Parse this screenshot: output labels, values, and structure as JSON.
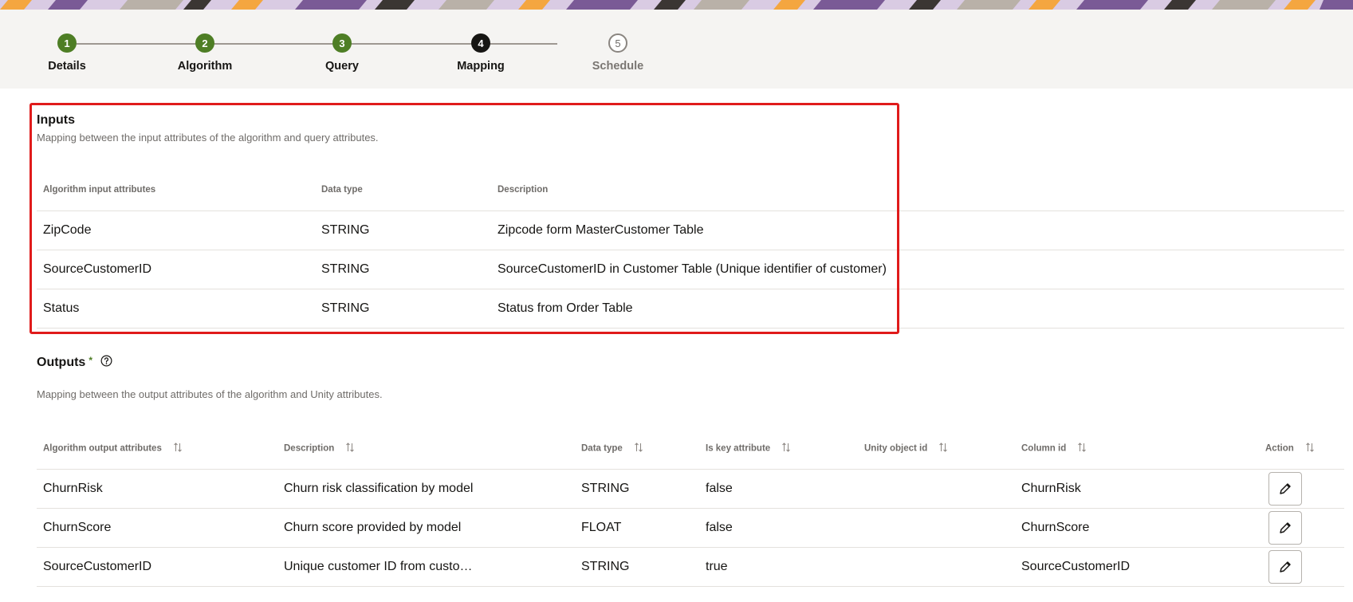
{
  "train": {
    "steps": [
      {
        "number": "1",
        "label": "Details",
        "state": "done"
      },
      {
        "number": "2",
        "label": "Algorithm",
        "state": "done"
      },
      {
        "number": "3",
        "label": "Query",
        "state": "done"
      },
      {
        "number": "4",
        "label": "Mapping",
        "state": "current"
      },
      {
        "number": "5",
        "label": "Schedule",
        "state": "pending"
      }
    ]
  },
  "inputs": {
    "title": "Inputs",
    "description": "Mapping between the input attributes of the algorithm and query attributes.",
    "columns": [
      "Algorithm input attributes",
      "Data type",
      "Description"
    ],
    "rows": [
      [
        "ZipCode",
        "STRING",
        "Zipcode form MasterCustomer Table"
      ],
      [
        "SourceCustomerID",
        "STRING",
        "SourceCustomerID in Customer Table (Unique identifier of customer)"
      ],
      [
        "Status",
        "STRING",
        "Status from Order Table"
      ]
    ]
  },
  "outputs": {
    "title": "Outputs",
    "required_mark": "*",
    "description": "Mapping between the output attributes of the algorithm and Unity attributes.",
    "columns": [
      "Algorithm output attributes",
      "Description",
      "Data type",
      "Is key attribute",
      "Unity object id",
      "Column id",
      "Action"
    ],
    "rows": [
      [
        "ChurnRisk",
        "Churn risk classification by model",
        "STRING",
        "false",
        "",
        "ChurnRisk"
      ],
      [
        "ChurnScore",
        "Churn score provided by model",
        "FLOAT",
        "false",
        "",
        "ChurnScore"
      ],
      [
        "SourceCustomerID",
        "Unique customer ID from custo…",
        "STRING",
        "true",
        "",
        "SourceCustomerID"
      ]
    ]
  },
  "icons": {
    "sort": "sort-icon",
    "help": "help-icon",
    "edit": "pencil-icon"
  },
  "colors": {
    "done": "#4e7e25",
    "current": "#161513",
    "highlight": "#e01b1b"
  }
}
